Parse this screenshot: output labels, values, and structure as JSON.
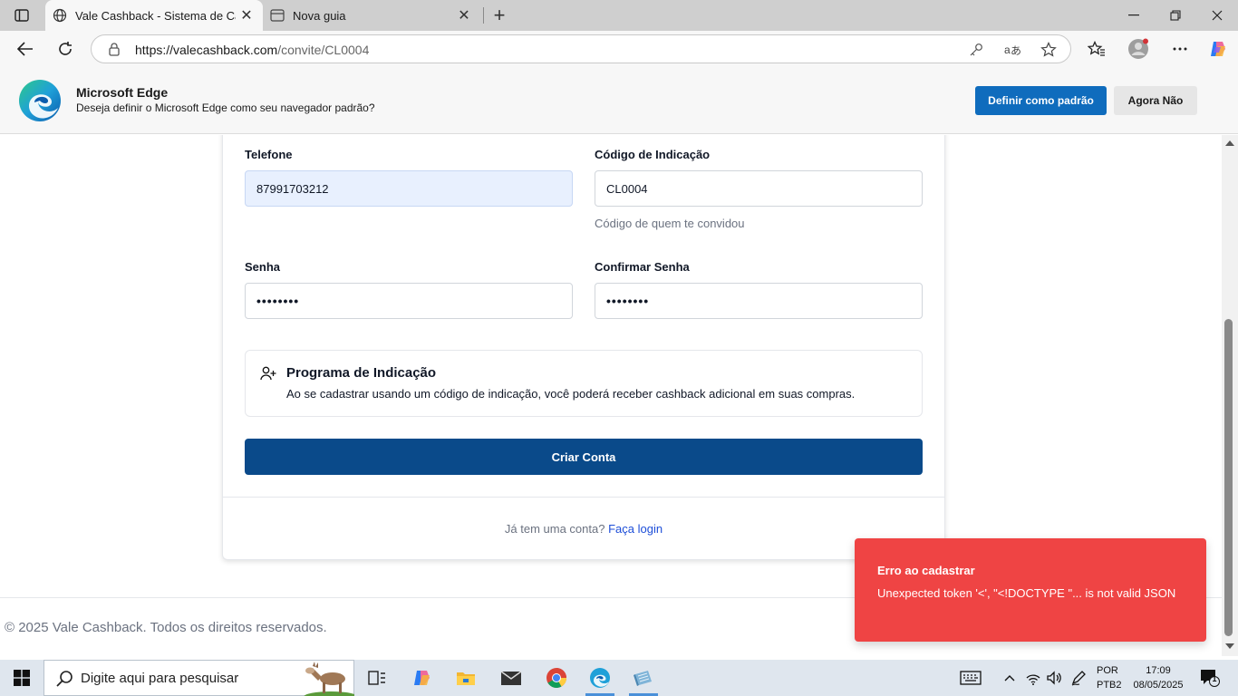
{
  "browser": {
    "tabs": [
      {
        "title": "Vale Cashback - Sistema de Cashb",
        "icon": "globe-icon"
      },
      {
        "title": "Nova guia",
        "icon": "page-icon"
      }
    ],
    "url_host": "https://valecashback.com",
    "url_path": "/convite/CL0004"
  },
  "infobar": {
    "title": "Microsoft Edge",
    "message": "Deseja definir o Microsoft Edge como seu navegador padrão?",
    "primary_button": "Definir como padrão",
    "secondary_button": "Agora Não"
  },
  "form": {
    "phone_label": "Telefone",
    "phone_value": "87991703212",
    "referral_label": "Código de Indicação",
    "referral_value": "CL0004",
    "referral_hint": "Código de quem te convidou",
    "password_label": "Senha",
    "password_value": "••••••••",
    "confirm_label": "Confirmar Senha",
    "confirm_value": "••••••••",
    "program_title": "Programa de Indicação",
    "program_text": "Ao se cadastrar usando um código de indicação, você poderá receber cashback adicional em suas compras.",
    "submit_label": "Criar Conta",
    "login_prompt": "Já tem uma conta?",
    "login_link": "Faça login"
  },
  "footer": {
    "text": "© 2025 Vale Cashback. Todos os direitos reservados."
  },
  "toast": {
    "title": "Erro ao cadastrar",
    "message": "Unexpected token '<', \"<!DOCTYPE \"... is not valid JSON"
  },
  "taskbar": {
    "search_placeholder": "Digite aqui para pesquisar",
    "lang_line1": "POR",
    "lang_line2": "PTB2",
    "time": "17:09",
    "date": "08/05/2025",
    "notification_count": "1"
  },
  "colors": {
    "primary": "#0a4a8a",
    "error": "#ef4444",
    "edge_blue": "#0f6cbd"
  }
}
